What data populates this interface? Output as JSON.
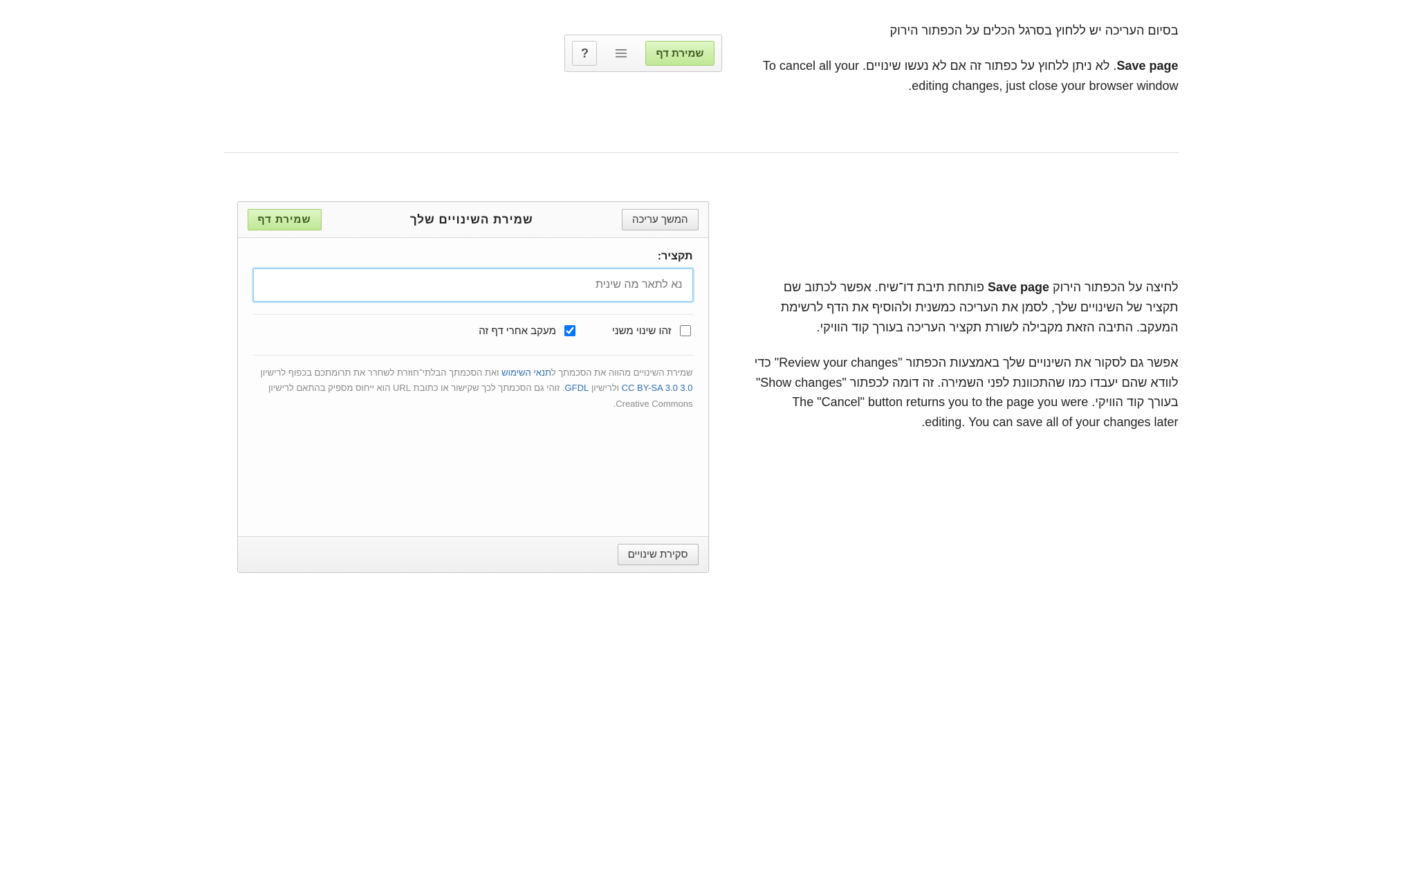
{
  "section1": {
    "para_intro": "בסיום העריכה יש ללחוץ בסרגל הכלים על הכפתור הירוק",
    "para_body_pre_bold": "",
    "para_body_bold": "Save page",
    "para_body_post": ". לא ניתן ללחוץ על כפתור זה אם לא נעשו שינויים. To cancel all your editing changes, just close your browser window."
  },
  "toolbar": {
    "help_label": "?",
    "save_label": "שמירת דף"
  },
  "section2": {
    "p1_pre": "לחיצה על הכפתור הירוק ",
    "p1_bold": "Save page",
    "p1_post": " פותחת תיבת דו־שיח. אפשר לכתוב שם תקציר של השינויים שלך, לסמן את העריכה כמשנית ולהוסיף את הדף לרשימת המעקב. התיבה הזאת מקבילה לשורת תקציר העריכה בעורך קוד הוויקי.",
    "p2": "אפשר גם לסקור את השינויים שלך באמצעות הכפתור \"Review your changes\" כדי לוודא שהם יעבדו כמו שהתכוונת לפני השמירה. זה דומה לכפתור \"Show changes\" בעורך קוד הוויקי. The \"Cancel\" button returns you to the page you were editing. You can save all of your changes later."
  },
  "dialog": {
    "continue_edit": "המשך עריכה",
    "title": "שמירת השינויים שלך",
    "save_page": "שמירת דף",
    "summary_label": "תקציר:",
    "summary_placeholder": "נא לתאר מה שינית",
    "minor_label": "זהו שינוי משני",
    "watch_label": "מעקב אחרי דף זה",
    "legal_pre": "שמירת השינויים מהווה את הסכמתך ל",
    "legal_link1": "תנאי השימוש",
    "legal_mid1": " ואת הסכמתך הבלתי־חוזרת לשחרר את תרומתכם בכפוף לרישיון ",
    "legal_link2": "CC BY-SA 3.0 3.0",
    "legal_mid2": " ולרישיון ",
    "legal_link3": "GFDL",
    "legal_post": ". זוהי גם הסכמתך לכך שקישור או כתובת URL הוא ייחוס מספיק בהתאם לרישיון Creative Commons.",
    "review_changes": "סקירת שינויים"
  }
}
